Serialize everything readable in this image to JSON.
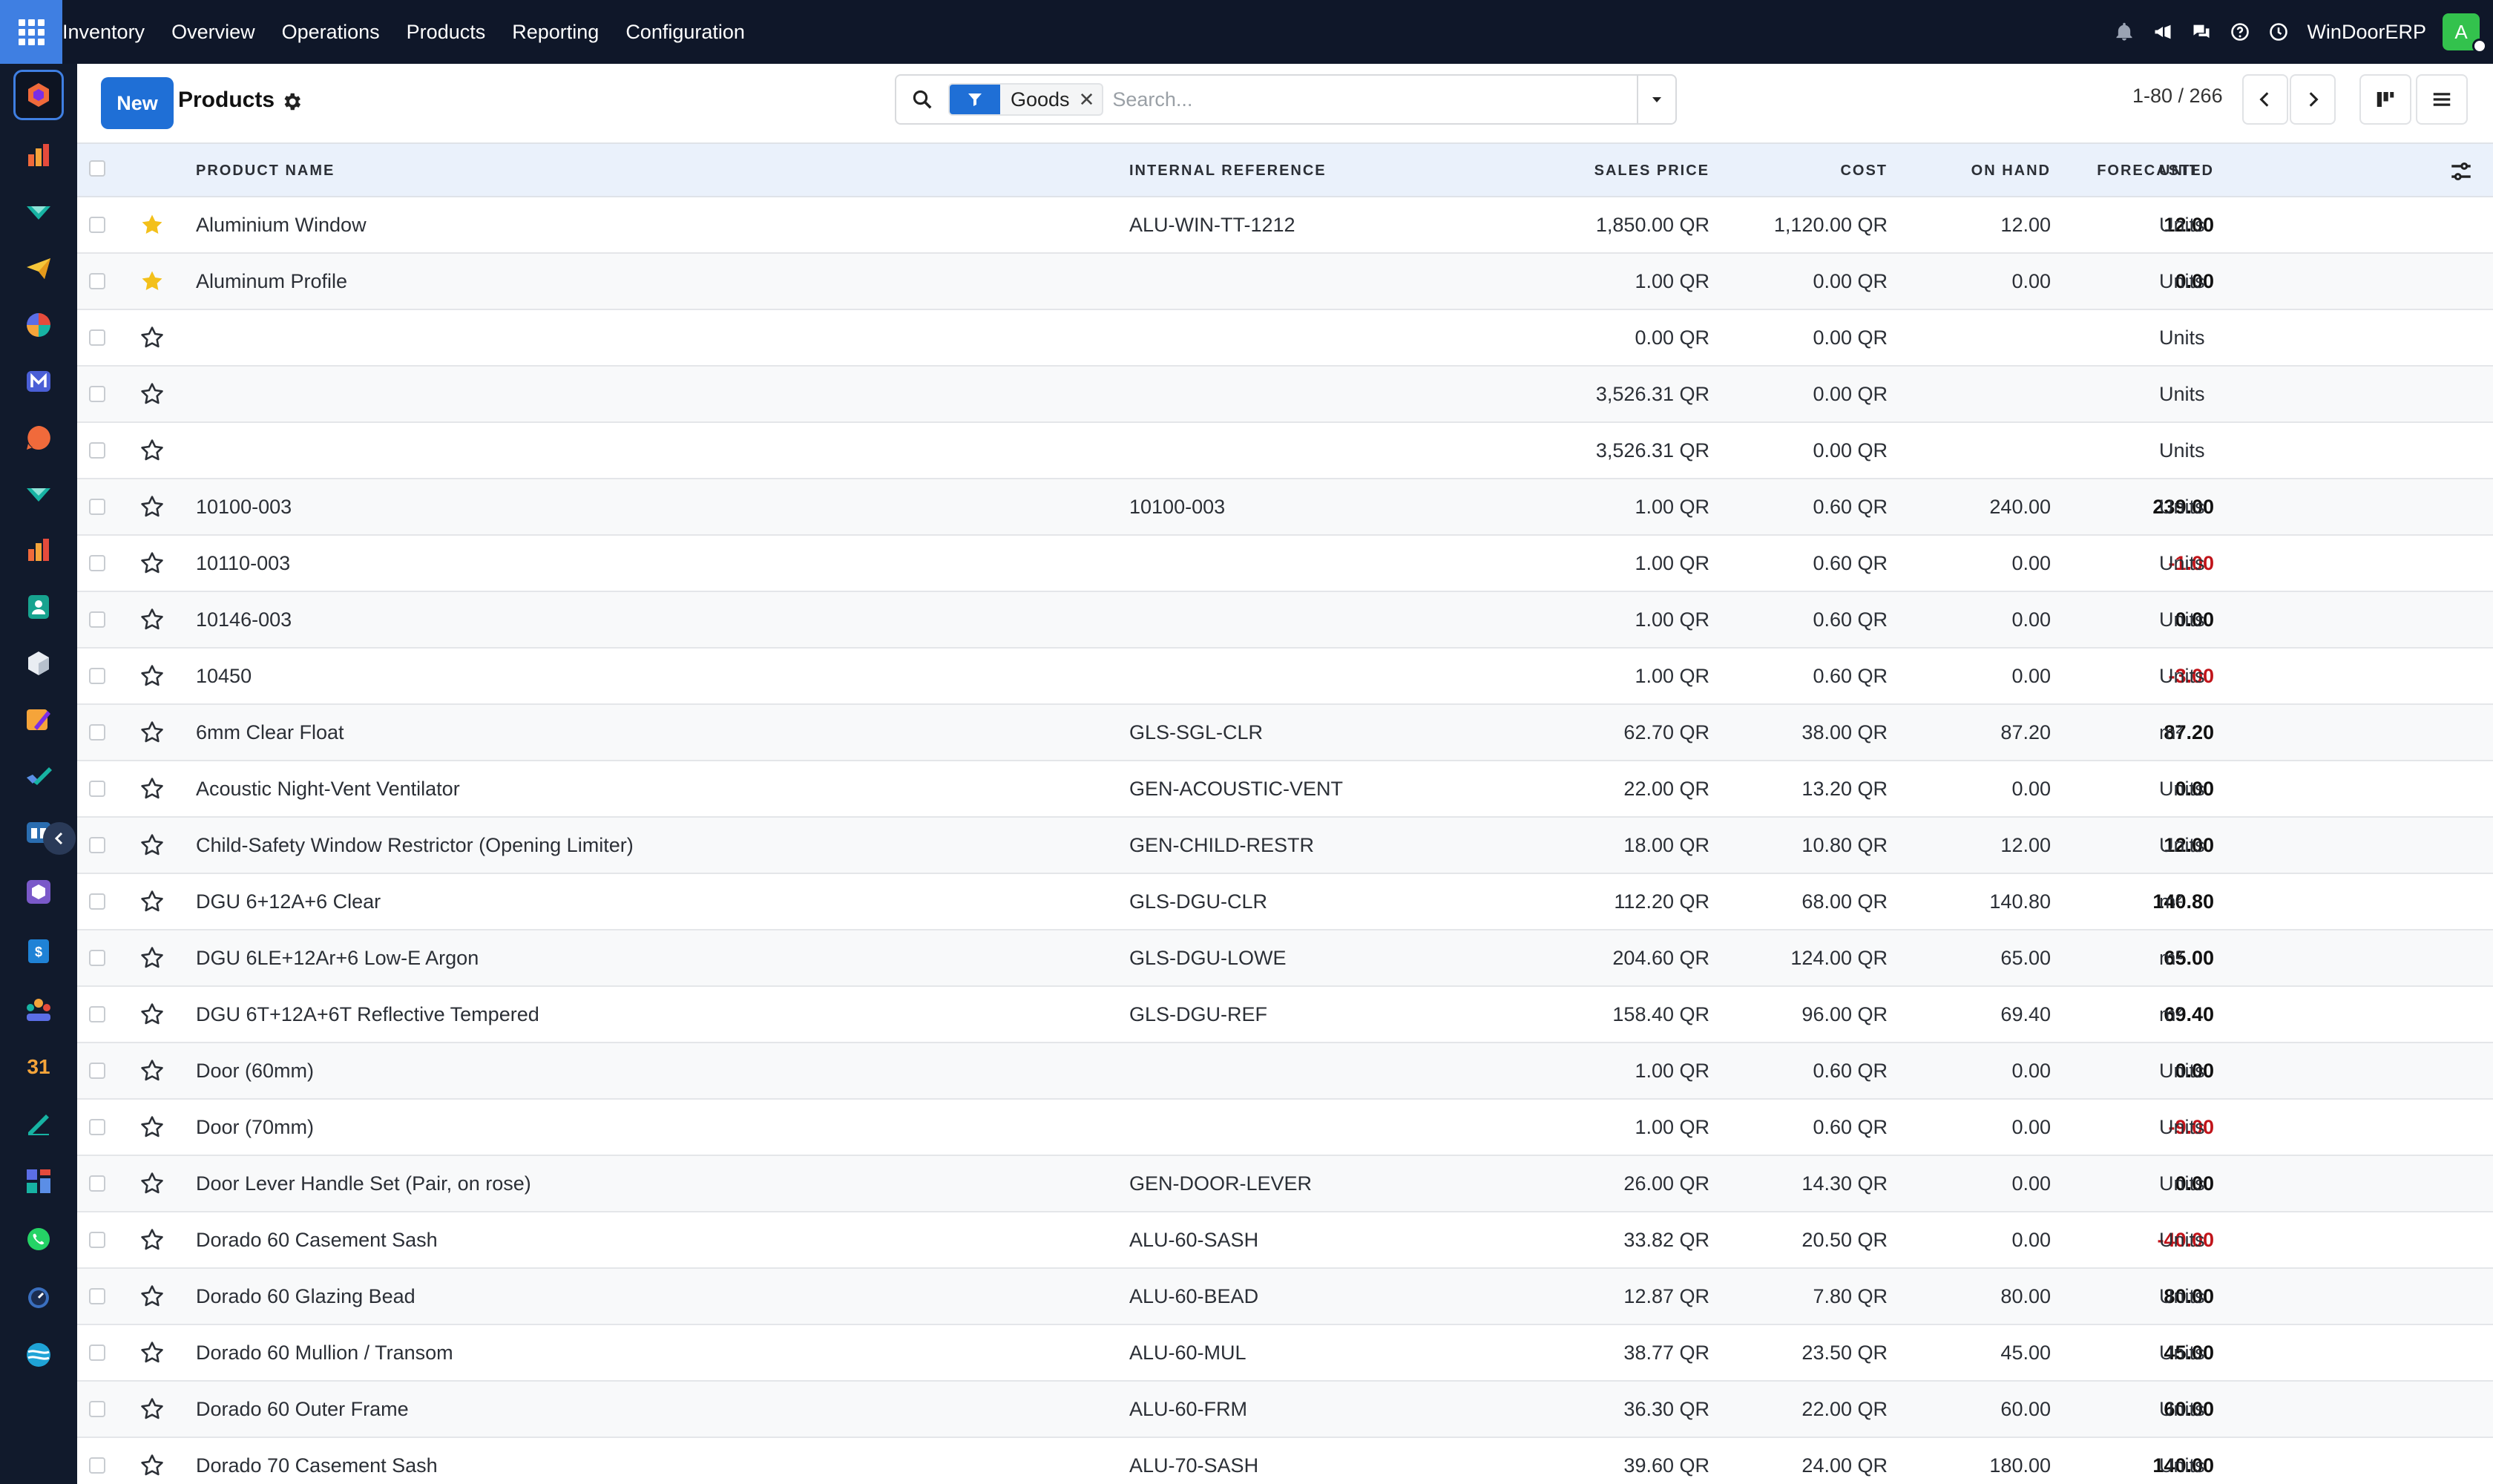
{
  "navbar": {
    "menu": [
      "Inventory",
      "Overview",
      "Operations",
      "Products",
      "Reporting",
      "Configuration"
    ],
    "company": "WinDoorERP",
    "avatar_letter": "A",
    "tray_icons": [
      "bell-icon",
      "megaphone-icon",
      "chat-icon",
      "help-icon",
      "clock-icon"
    ]
  },
  "rail": {
    "apps": [
      "inventory-app-icon",
      "reports-app-icon",
      "crm-app-icon",
      "email-app-icon",
      "pie-app-icon",
      "mail-m-app-icon",
      "chat-app-icon",
      "sales-app-icon",
      "spreadsheet-app-icon",
      "contacts-app-icon",
      "product-app-icon",
      "studio-app-icon",
      "tasks-app-icon",
      "knowledge-app-icon",
      "box-app-icon",
      "invoice-app-icon",
      "employees-app-icon",
      "calendar-app-icon",
      "sign-app-icon",
      "dashboard-app-icon",
      "whatsapp-app-icon",
      "timer-app-icon",
      "website-app-icon"
    ],
    "calendar_day": "31"
  },
  "control": {
    "new_label": "New",
    "title": "Products",
    "facet": "Goods",
    "facet_remove": "✕",
    "search_placeholder": "Search...",
    "pager": "1-80 / 266"
  },
  "columns": {
    "name": "PRODUCT NAME",
    "ref": "INTERNAL REFERENCE",
    "price": "SALES PRICE",
    "cost": "COST",
    "onhand": "ON HAND",
    "forecast": "FORECASTED",
    "unit": "UNIT"
  },
  "rows": [
    {
      "fav": true,
      "name": "Aluminium Window",
      "ref": "ALU-WIN-TT-1212",
      "price": "1,850.00 QR",
      "cost": "1,120.00 QR",
      "onhand": "12.00",
      "forecast": "12.00",
      "neg": false,
      "unit": "Units"
    },
    {
      "fav": true,
      "name": "Aluminum Profile",
      "ref": "",
      "price": "1.00 QR",
      "cost": "0.00 QR",
      "onhand": "0.00",
      "forecast": "0.00",
      "neg": false,
      "unit": "Units"
    },
    {
      "fav": false,
      "name": "",
      "ref": "",
      "price": "0.00 QR",
      "cost": "0.00 QR",
      "onhand": "",
      "forecast": "",
      "neg": false,
      "unit": "Units"
    },
    {
      "fav": false,
      "name": "",
      "ref": "",
      "price": "3,526.31 QR",
      "cost": "0.00 QR",
      "onhand": "",
      "forecast": "",
      "neg": false,
      "unit": "Units"
    },
    {
      "fav": false,
      "name": "",
      "ref": "",
      "price": "3,526.31 QR",
      "cost": "0.00 QR",
      "onhand": "",
      "forecast": "",
      "neg": false,
      "unit": "Units"
    },
    {
      "fav": false,
      "name": "10100-003",
      "ref": "10100-003",
      "price": "1.00 QR",
      "cost": "0.60 QR",
      "onhand": "240.00",
      "forecast": "239.00",
      "neg": false,
      "unit": "Units"
    },
    {
      "fav": false,
      "name": "10110-003",
      "ref": "",
      "price": "1.00 QR",
      "cost": "0.60 QR",
      "onhand": "0.00",
      "forecast": "-1.00",
      "neg": true,
      "unit": "Units"
    },
    {
      "fav": false,
      "name": "10146-003",
      "ref": "",
      "price": "1.00 QR",
      "cost": "0.60 QR",
      "onhand": "0.00",
      "forecast": "0.00",
      "neg": false,
      "unit": "Units"
    },
    {
      "fav": false,
      "name": "10450",
      "ref": "",
      "price": "1.00 QR",
      "cost": "0.60 QR",
      "onhand": "0.00",
      "forecast": "-3.00",
      "neg": true,
      "unit": "Units"
    },
    {
      "fav": false,
      "name": "6mm Clear Float",
      "ref": "GLS-SGL-CLR",
      "price": "62.70 QR",
      "cost": "38.00 QR",
      "onhand": "87.20",
      "forecast": "87.20",
      "neg": false,
      "unit": "m²"
    },
    {
      "fav": false,
      "name": "Acoustic Night-Vent Ventilator",
      "ref": "GEN-ACOUSTIC-VENT",
      "price": "22.00 QR",
      "cost": "13.20 QR",
      "onhand": "0.00",
      "forecast": "0.00",
      "neg": false,
      "unit": "Units"
    },
    {
      "fav": false,
      "name": "Child-Safety Window Restrictor (Opening Limiter)",
      "ref": "GEN-CHILD-RESTR",
      "price": "18.00 QR",
      "cost": "10.80 QR",
      "onhand": "12.00",
      "forecast": "12.00",
      "neg": false,
      "unit": "Units"
    },
    {
      "fav": false,
      "name": "DGU 6+12A+6 Clear",
      "ref": "GLS-DGU-CLR",
      "price": "112.20 QR",
      "cost": "68.00 QR",
      "onhand": "140.80",
      "forecast": "140.80",
      "neg": false,
      "unit": "m²"
    },
    {
      "fav": false,
      "name": "DGU 6LE+12Ar+6 Low-E Argon",
      "ref": "GLS-DGU-LOWE",
      "price": "204.60 QR",
      "cost": "124.00 QR",
      "onhand": "65.00",
      "forecast": "65.00",
      "neg": false,
      "unit": "m²"
    },
    {
      "fav": false,
      "name": "DGU 6T+12A+6T Reflective Tempered",
      "ref": "GLS-DGU-REF",
      "price": "158.40 QR",
      "cost": "96.00 QR",
      "onhand": "69.40",
      "forecast": "69.40",
      "neg": false,
      "unit": "m²"
    },
    {
      "fav": false,
      "name": "Door (60mm)",
      "ref": "",
      "price": "1.00 QR",
      "cost": "0.60 QR",
      "onhand": "0.00",
      "forecast": "0.00",
      "neg": false,
      "unit": "Units"
    },
    {
      "fav": false,
      "name": "Door (70mm)",
      "ref": "",
      "price": "1.00 QR",
      "cost": "0.60 QR",
      "onhand": "0.00",
      "forecast": "-9.00",
      "neg": true,
      "unit": "Units"
    },
    {
      "fav": false,
      "name": "Door Lever Handle Set (Pair, on rose)",
      "ref": "GEN-DOOR-LEVER",
      "price": "26.00 QR",
      "cost": "14.30 QR",
      "onhand": "0.00",
      "forecast": "0.00",
      "neg": false,
      "unit": "Units"
    },
    {
      "fav": false,
      "name": "Dorado 60 Casement Sash",
      "ref": "ALU-60-SASH",
      "price": "33.82 QR",
      "cost": "20.50 QR",
      "onhand": "0.00",
      "forecast": "-40.00",
      "neg": true,
      "unit": "Units"
    },
    {
      "fav": false,
      "name": "Dorado 60 Glazing Bead",
      "ref": "ALU-60-BEAD",
      "price": "12.87 QR",
      "cost": "7.80 QR",
      "onhand": "80.00",
      "forecast": "80.00",
      "neg": false,
      "unit": "Units"
    },
    {
      "fav": false,
      "name": "Dorado 60 Mullion / Transom",
      "ref": "ALU-60-MUL",
      "price": "38.77 QR",
      "cost": "23.50 QR",
      "onhand": "45.00",
      "forecast": "45.00",
      "neg": false,
      "unit": "Units"
    },
    {
      "fav": false,
      "name": "Dorado 60 Outer Frame",
      "ref": "ALU-60-FRM",
      "price": "36.30 QR",
      "cost": "22.00 QR",
      "onhand": "60.00",
      "forecast": "60.00",
      "neg": false,
      "unit": "Units"
    },
    {
      "fav": false,
      "name": "Dorado 70 Casement Sash",
      "ref": "ALU-70-SASH",
      "price": "39.60 QR",
      "cost": "24.00 QR",
      "onhand": "180.00",
      "forecast": "140.00",
      "neg": false,
      "unit": "Units"
    }
  ],
  "colors": {
    "navbar": "#0f1729",
    "primary": "#1f6fd6",
    "negative": "#c0141a",
    "favorite": "#f3c01a",
    "header_bg": "#eaf1fb"
  }
}
